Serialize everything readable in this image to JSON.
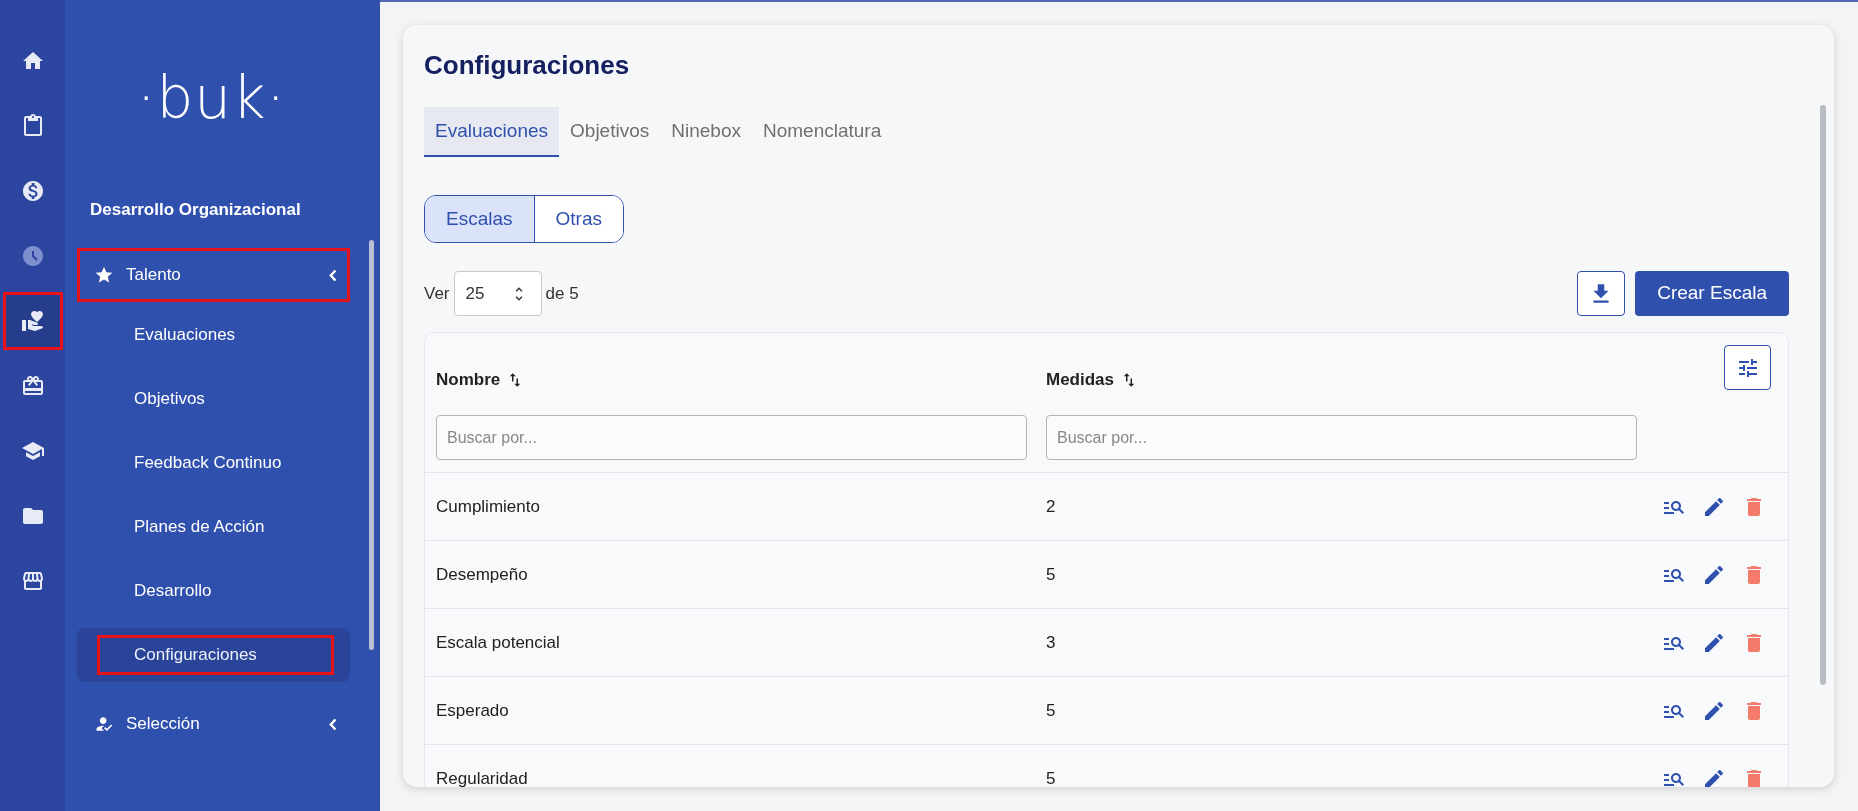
{
  "rail": {
    "items": [
      {
        "selected": false,
        "disabled": false,
        "highlighted": false
      },
      {
        "selected": false,
        "disabled": false,
        "highlighted": false
      },
      {
        "selected": false,
        "disabled": false,
        "highlighted": false
      },
      {
        "selected": false,
        "disabled": true,
        "highlighted": false
      },
      {
        "selected": true,
        "disabled": false,
        "highlighted": true
      },
      {
        "selected": false,
        "disabled": false,
        "highlighted": false
      },
      {
        "selected": false,
        "disabled": false,
        "highlighted": false
      },
      {
        "selected": false,
        "disabled": false,
        "highlighted": false
      },
      {
        "selected": false,
        "disabled": false,
        "highlighted": false
      }
    ]
  },
  "sidebar": {
    "logo": "·buk·",
    "section": "Desarrollo Organizacional",
    "groups": [
      {
        "label": "Talento",
        "highlighted": true,
        "children": [
          {
            "label": "Evaluaciones",
            "selected": false,
            "highlighted": false
          },
          {
            "label": "Objetivos",
            "selected": false,
            "highlighted": false
          },
          {
            "label": "Feedback Continuo",
            "selected": false,
            "highlighted": false
          },
          {
            "label": "Planes de Acción",
            "selected": false,
            "highlighted": false
          },
          {
            "label": "Desarrollo",
            "selected": false,
            "highlighted": false
          },
          {
            "label": "Configuraciones",
            "selected": true,
            "highlighted": true
          }
        ]
      },
      {
        "label": "Selección",
        "highlighted": false
      }
    ]
  },
  "main": {
    "title": "Configuraciones",
    "tabs": [
      {
        "label": "Evaluaciones",
        "selected": true
      },
      {
        "label": "Objetivos",
        "selected": false
      },
      {
        "label": "Ninebox",
        "selected": false
      },
      {
        "label": "Nomenclatura",
        "selected": false
      }
    ],
    "segments": [
      {
        "label": "Escalas",
        "selected": true
      },
      {
        "label": "Otras",
        "selected": false
      }
    ],
    "page_size": {
      "prefix": "Ver",
      "value": "25",
      "suffix": "de 5"
    },
    "create_button": "Crear Escala",
    "table": {
      "columns": [
        {
          "label": "Nombre",
          "placeholder": "Buscar por..."
        },
        {
          "label": "Medidas",
          "placeholder": "Buscar por..."
        }
      ],
      "rows": [
        {
          "cells": [
            "Cumplimiento",
            "2"
          ]
        },
        {
          "cells": [
            "Desempeño",
            "5"
          ]
        },
        {
          "cells": [
            "Escala potencial",
            "3"
          ]
        },
        {
          "cells": [
            "Esperado",
            "5"
          ]
        },
        {
          "cells": [
            "Regularidad",
            "5"
          ]
        }
      ]
    }
  }
}
